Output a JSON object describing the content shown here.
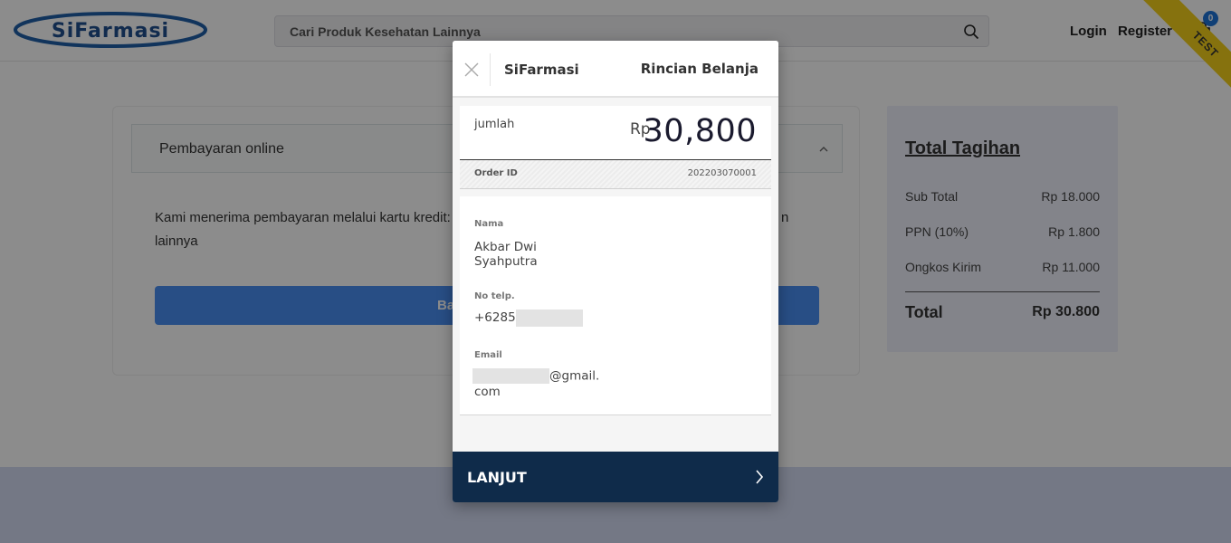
{
  "header": {
    "logo_text": "SiFarmasi",
    "search_placeholder": "Cari Produk Kesehatan Lainnya",
    "login_label": "Login",
    "register_label": "Register",
    "cart_count": "0",
    "ribbon_text": "TEST"
  },
  "payment": {
    "tab_label": "Pembayaran online",
    "description": "Kami menerima pembayaran melalui kartu kredit: ... n lainnya",
    "description_line1": "Kami menerima pembayaran melalui kartu kredit:",
    "description_line1_tail": "n",
    "description_line2": "lainnya",
    "button_label_visible": "Ba"
  },
  "summary": {
    "title": "Total Tagihan",
    "rows": [
      {
        "label": "Sub Total",
        "amount": "Rp 18.000"
      },
      {
        "label": "PPN (10%)",
        "amount": "Rp 1.800"
      },
      {
        "label": "Ongkos Kirim",
        "amount": "Rp 11.000"
      }
    ],
    "total_label": "Total",
    "total_amount": "Rp 30.800"
  },
  "modal": {
    "brand": "SiFarmasi",
    "title": "Rincian Belanja",
    "amount_label": "jumlah",
    "currency": "Rp",
    "amount": "30,800",
    "order_id_label": "Order ID",
    "order_id": "202203070001",
    "name_label": "Nama",
    "name_line1": "Akbar Dwi",
    "name_line2": "Syahputra",
    "phone_label": "No telp.",
    "phone_prefix": "+6285",
    "email_label": "Email",
    "email_domain": "@gmail.",
    "email_tld": "com",
    "cta_label": "LANJUT"
  },
  "colors": {
    "modal_cta_bg": "#0f2b4a",
    "pay_button_bg": "#4a8ff3",
    "ribbon": "#f4d01a",
    "badge": "#1e73d8"
  },
  "icons": {
    "search": "search-icon",
    "cart": "cart-icon",
    "close": "close-icon",
    "chevron_up": "chevron-up-icon",
    "chevron_right": "chevron-right-icon"
  }
}
